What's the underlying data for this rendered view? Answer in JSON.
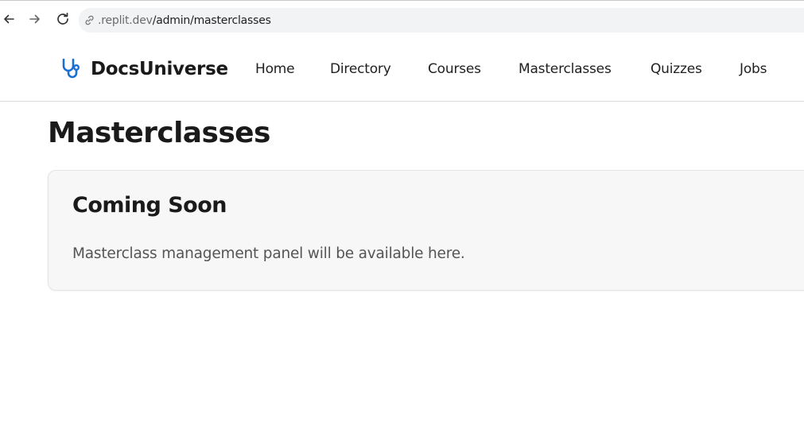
{
  "browser": {
    "url_host": ".replit.dev",
    "url_path": "/admin/masterclasses",
    "icons": {
      "back": "arrow-left-icon",
      "forward": "arrow-right-icon",
      "reload": "reload-icon",
      "site_info": "link-icon"
    }
  },
  "header": {
    "brand": {
      "name": "DocsUniverse",
      "icon": "stethoscope-icon",
      "icon_color": "#1a6fd4"
    },
    "nav": [
      {
        "label": "Home"
      },
      {
        "label": "Directory"
      },
      {
        "label": "Courses"
      },
      {
        "label": "Masterclasses"
      },
      {
        "label": "Quizzes"
      },
      {
        "label": "Jobs"
      }
    ]
  },
  "main": {
    "title": "Masterclasses",
    "card": {
      "title": "Coming Soon",
      "text": "Masterclass management panel will be available here."
    }
  }
}
